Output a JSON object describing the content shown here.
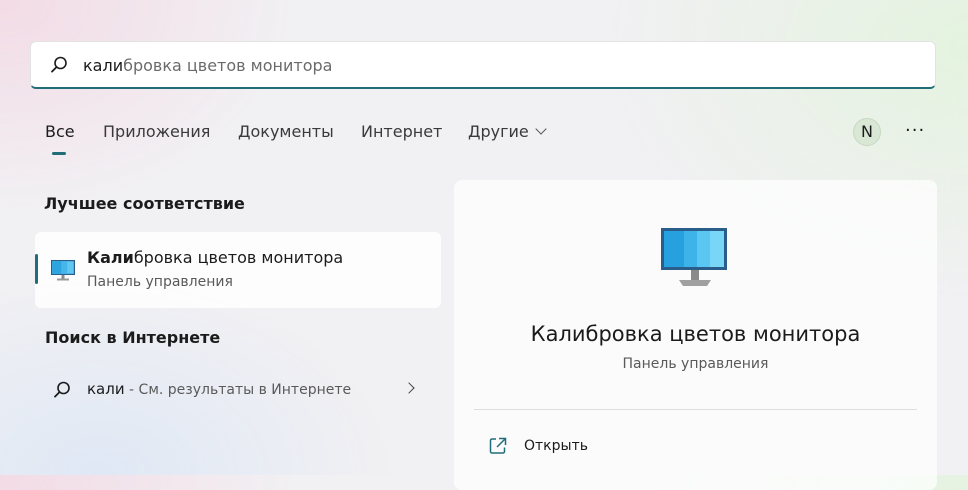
{
  "search": {
    "typed": "кали",
    "completion": "бровка цветов монитора",
    "icon": "search-icon"
  },
  "tabs": [
    {
      "label": "Все",
      "active": true
    },
    {
      "label": "Приложения"
    },
    {
      "label": "Документы"
    },
    {
      "label": "Интернет"
    },
    {
      "label": "Другие"
    }
  ],
  "header": {
    "avatar_initial": "N",
    "more_label": "···"
  },
  "best_match": {
    "section_title": "Лучшее соответствие",
    "title_bold": "Кали",
    "title_rest": "бровка цветов монитора",
    "subtitle": "Панель управления",
    "icon": "monitor-icon"
  },
  "web_search": {
    "section_title": "Поиск в Интернете",
    "query": "кали",
    "suffix": " - См. результаты в Интернете",
    "icon": "search-icon"
  },
  "details": {
    "title": "Калибровка цветов монитора",
    "subtitle": "Панель управления",
    "open_label": "Открыть",
    "icon": "monitor-icon"
  },
  "colors": {
    "accent": "#1f6d78"
  }
}
